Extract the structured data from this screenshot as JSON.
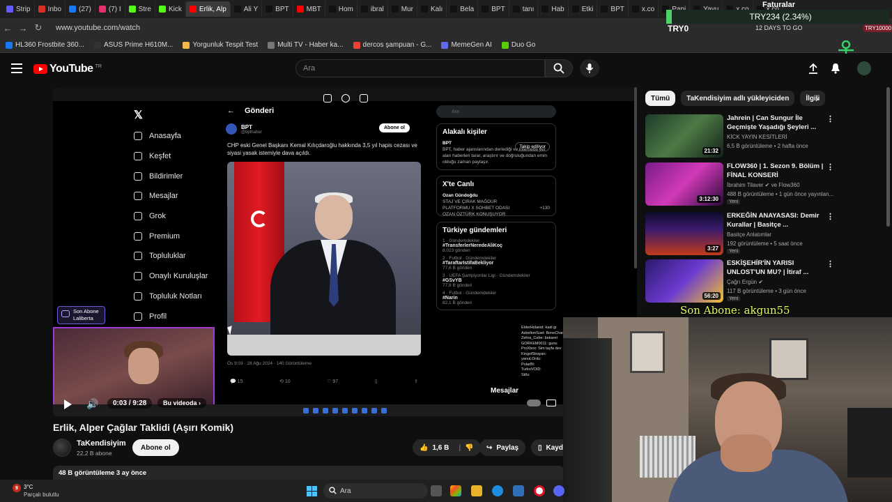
{
  "browser": {
    "tabs": [
      "Strip",
      "Inbo",
      "(27)",
      "(7) I",
      "Stre",
      "Kick",
      "Erlik, Alp",
      "Ali Y",
      "BPT",
      "MBT",
      "Hom",
      "ibral",
      "Mur",
      "Kalı",
      "Bela",
      "BPT",
      "tanı",
      "Hab",
      "Etki",
      "BPT",
      "x.co",
      "Papi",
      "Yavu",
      "x.co",
      "x.co"
    ],
    "url": "www.youtube.com/watch",
    "bookmarks": [
      "HL360 Frostbite 360...",
      "ASUS Prime H610M...",
      "Yorgunluk Tespit Test",
      "Multi TV - Haber ka...",
      "dercos şampuan - G...",
      "MemeGen AI",
      "Duo Go"
    ]
  },
  "overlay": {
    "faturalar": "Faturalar",
    "ticker": "TRY234 (2.34%)",
    "try0": "TRY0",
    "days_to_go": "12 DAYS TO GO",
    "try_right": "TRY10000",
    "son_abone": "Son Abone: akgun55"
  },
  "youtube": {
    "logo_text": "YouTube",
    "country": "TR",
    "search_placeholder": "Ara"
  },
  "player": {
    "x_nav": [
      "Anasayfa",
      "Keşfet",
      "Bildirimler",
      "Mesajlar",
      "Grok",
      "Premium",
      "Topluluklar",
      "Onaylı Kuruluşlar",
      "Topluluk Notları",
      "Profil"
    ],
    "post_header": "Gönderi",
    "post_author": "BPT",
    "post_handle": "@bpthaber",
    "follow_btn": "Abone ol",
    "post_text": "CHP eski Genel Başkanı Kemal Kılıçdaroğlu hakkında 3,5 yıl hapis cezası ve siyasi yasak istemiyle dava açıldı.",
    "post_meta": "Ös 9:03 · 28 Ağu 2024 · 140 Görüntüleme",
    "post_actions": [
      "15",
      "10",
      "97",
      ""
    ],
    "x_search": "Ara",
    "related_title": "Alakalı kişiler",
    "related_name": "BPT",
    "related_desc": "BPT, haber ajanslarından derlediği ve internette yer alan haberleri tarar, araştırır ve doğruluğundan emin olduğu zaman paylaşır.",
    "related_btn": "Takip ediliyor",
    "live_title": "X'te Canlı",
    "live_name": "Ozan Gündoğdu",
    "live_desc": "STAJ VE ÇIRAK MAĞDUR PLATFORMU X SOHBET ODASI OZAN ÖZTÜRK KONUŞUYOR",
    "live_count": "+130",
    "trends_title": "Türkiye gündemleri",
    "trends": [
      {
        "label": "1 · Gündemdekiler",
        "tag": "#TransferlerNeredeAliKoç",
        "count": "8.023 gönderi"
      },
      {
        "label": "2 · Futbol · Gündemdekiler",
        "tag": "#TaraftarIstifaBekliyor",
        "count": "77,6 B gönderi"
      },
      {
        "label": "3 · UEFA Şampiyonlar Ligi · Gündemdekiler",
        "tag": "#GSvYB",
        "count": "77,8 B gönderi"
      },
      {
        "label": "4 · Futbol · Gündemdekiler",
        "tag": "#Narin",
        "count": "82,1 B gönderi"
      }
    ],
    "chat": [
      "ElderHolanid: kadi gi",
      "AsbellonSuet: BoneChamp",
      "Zehra_Cebe: bekaret",
      "GORKEM0011: gunu",
      "ProXbox: Sim tayfa dev",
      "KingofStrayan: ",
      "yanuLOrdu: ",
      "PolarBl: ",
      "TurkoVOID: ",
      "Stifu: "
    ],
    "messages": "Mesajlar",
    "sub_badge_line1": "Son Abone",
    "sub_badge_line2": "Laliberta",
    "watermark": "purplefable",
    "time": "0:03 / 9:28",
    "bu_videoda": "Bu videoda"
  },
  "video": {
    "title": "Erlik, Alper Çağlar Taklidi (Aşırı Komik)",
    "channel": "TaKendisiyim",
    "subscribers": "22,2 B abone",
    "subscribe_btn": "Abone ol",
    "likes": "1,6 B",
    "share": "Paylaş",
    "save": "Kaydet",
    "views_line": "48 B görüntüleme  3 ay önce"
  },
  "sidebar": {
    "chips": [
      "Tümü",
      "TaKendisiyim adlı yükleyiciden",
      "İlgili"
    ],
    "items": [
      {
        "title": "Jahrein | Can Sungur İle Geçmişte Yaşadığı Şeyleri ...",
        "channel": "KİCK YAYIN KESİTLERİ",
        "meta": "6,5 B görüntüleme • 2 hafta önce",
        "duration": "21:32",
        "badge": ""
      },
      {
        "title": "FLOW360 | 1. Sezon 9. Bölüm | FİNAL KONSERİ",
        "channel": "İbrahim Tilaver ✔ ve Flow360",
        "meta": "488 B görüntüleme • 1 gün önce yayınlan...",
        "duration": "3:12:30",
        "badge": "Yeni"
      },
      {
        "title": "ERKEĞİN ANAYASASI: Demir Kurallar | Basitçe ...",
        "channel": "Basitçe Anlatımlar",
        "meta": "192 görüntüleme • 5 saat önce",
        "duration": "3:27",
        "badge": "Yeni"
      },
      {
        "title": "ESKİŞEHİR'İN YARISI UNLOST'UN MU? | İtiraf ...",
        "channel": "Çağrı Ergün ✔",
        "meta": "117 B görüntüleme • 3 gün önce",
        "duration": "56:20",
        "badge": "Yeni"
      }
    ]
  },
  "taskbar": {
    "notif_count": "9",
    "temp": "3°C",
    "condition": "Parçalı bulutlu",
    "search": "Ara"
  }
}
